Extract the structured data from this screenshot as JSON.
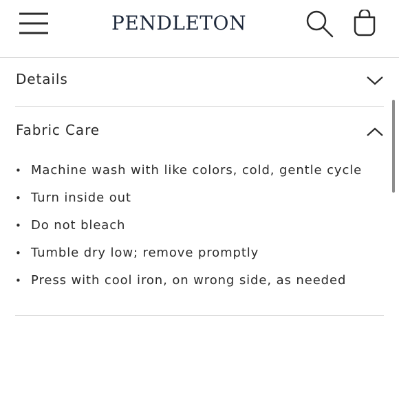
{
  "header": {
    "logo_text": "PENDLETON",
    "icons": {
      "menu": "hamburger-menu-icon",
      "search": "search-icon",
      "bag": "shopping-bag-icon"
    }
  },
  "accordion": {
    "details": {
      "title": "Details",
      "expanded": false
    },
    "fabric_care": {
      "title": "Fabric Care",
      "expanded": true,
      "items": [
        "Machine wash with like colors, cold, gentle cycle",
        "Turn inside out",
        "Do not bleach",
        "Tumble dry low; remove promptly",
        "Press with cool iron, on wrong side, as needed"
      ]
    }
  },
  "colors": {
    "text": "#2b2b2b",
    "logo": "#1f2a3c",
    "divider": "#d9d9d9"
  }
}
